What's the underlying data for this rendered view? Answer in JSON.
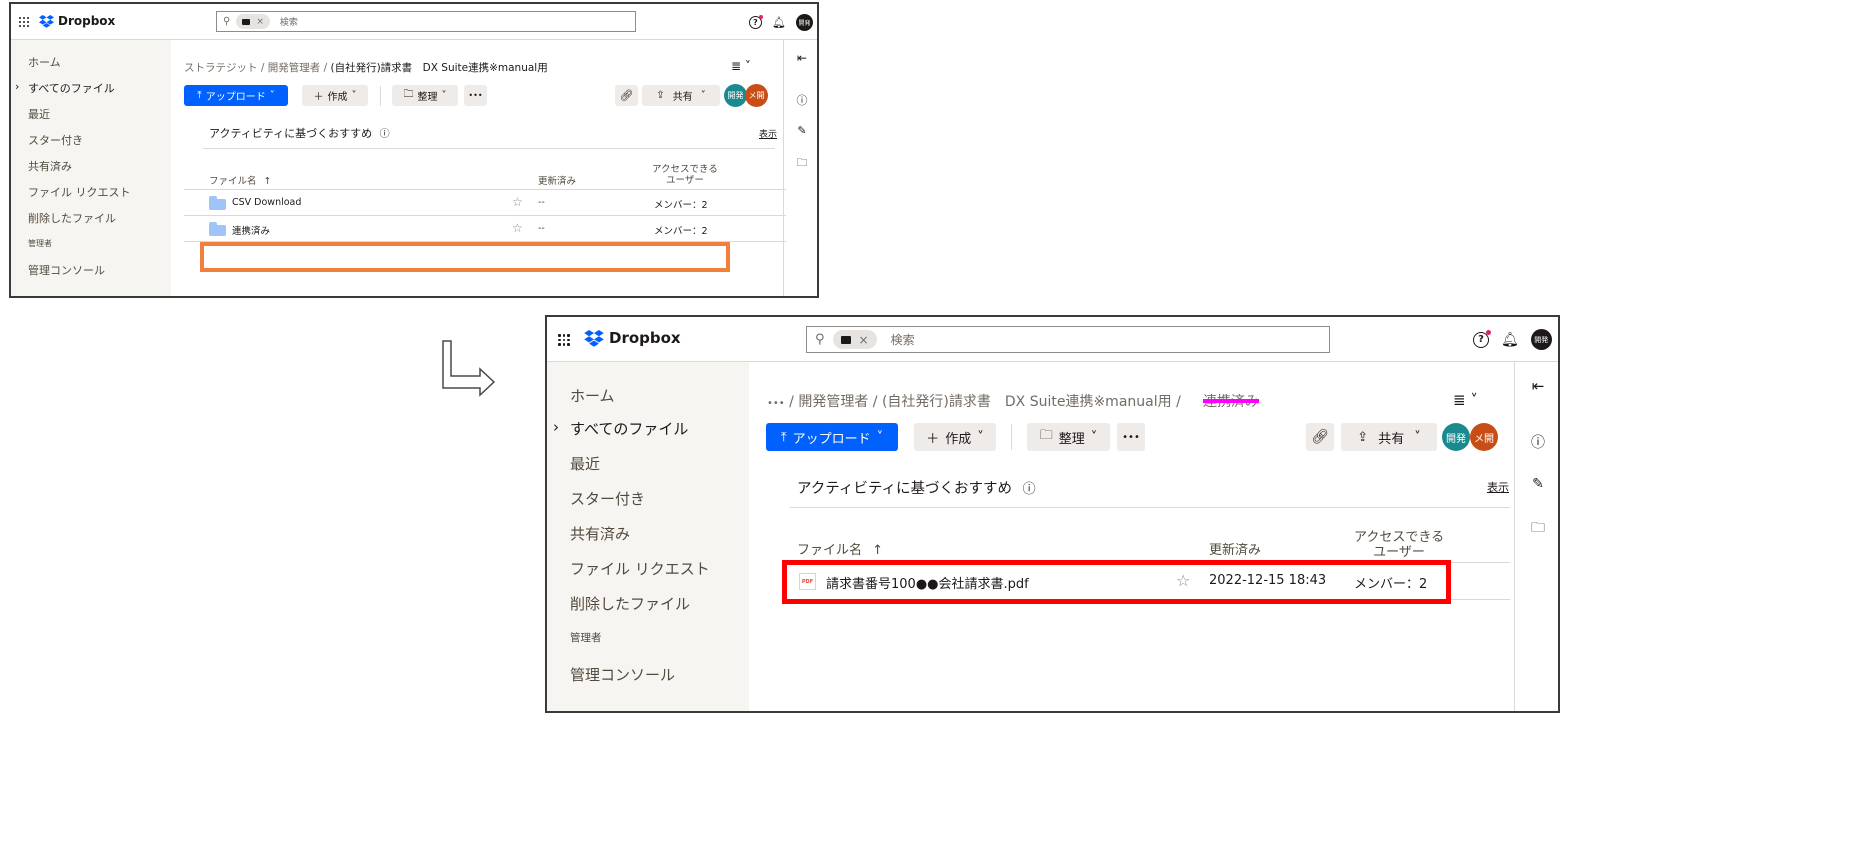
{
  "brand": "Dropbox",
  "search": {
    "chip_close": "×",
    "placeholder": "検索"
  },
  "top": {
    "help": "?",
    "avatar": "開発"
  },
  "sidebar": {
    "items": [
      "ホーム",
      "すべてのファイル",
      "最近",
      "スター付き",
      "共有済み",
      "ファイル リクエスト",
      "削除したファイル",
      "管理者",
      "管理コンソール"
    ]
  },
  "toolbar": {
    "upload": "アップロード",
    "create": "作成",
    "organize": "整理",
    "more": "•••",
    "share": "共有"
  },
  "avatars": {
    "a1": "開発",
    "a2": "メ開"
  },
  "suggest": {
    "label": "アクティビティに基づくおすすめ",
    "show": "表示"
  },
  "columns": {
    "name": "ファイル名",
    "modified": "更新済み",
    "access": "アクセスできる\nユーザー"
  },
  "before": {
    "breadcrumb": {
      "p1": "ストラテジット",
      "sep": "/",
      "p2": "開発管理者",
      "current": "(自社発行)請求書　DX Suite連携※manual用"
    },
    "rows": [
      {
        "name": "CSV Download",
        "modified": "--",
        "access": "メンバー：2"
      },
      {
        "name": "連携済み",
        "modified": "--",
        "access": "メンバー：2"
      }
    ]
  },
  "after": {
    "breadcrumb": {
      "ellipsis": "•••",
      "sep": "/",
      "p2": "開発管理者",
      "p3": "(自社発行)請求書　DX Suite連携※manual用",
      "current": "連携済み"
    },
    "rows": [
      {
        "icon": "PDF",
        "name": "請求書番号100●●会社請求書.pdf",
        "modified": "2022-12-15 18:43",
        "access": "メンバー：2"
      }
    ]
  },
  "colors": {
    "primary": "#0061fe",
    "orange_highlight": "#f0803c",
    "red_highlight": "#ff0000",
    "magenta_strike": "#ff00ff"
  }
}
